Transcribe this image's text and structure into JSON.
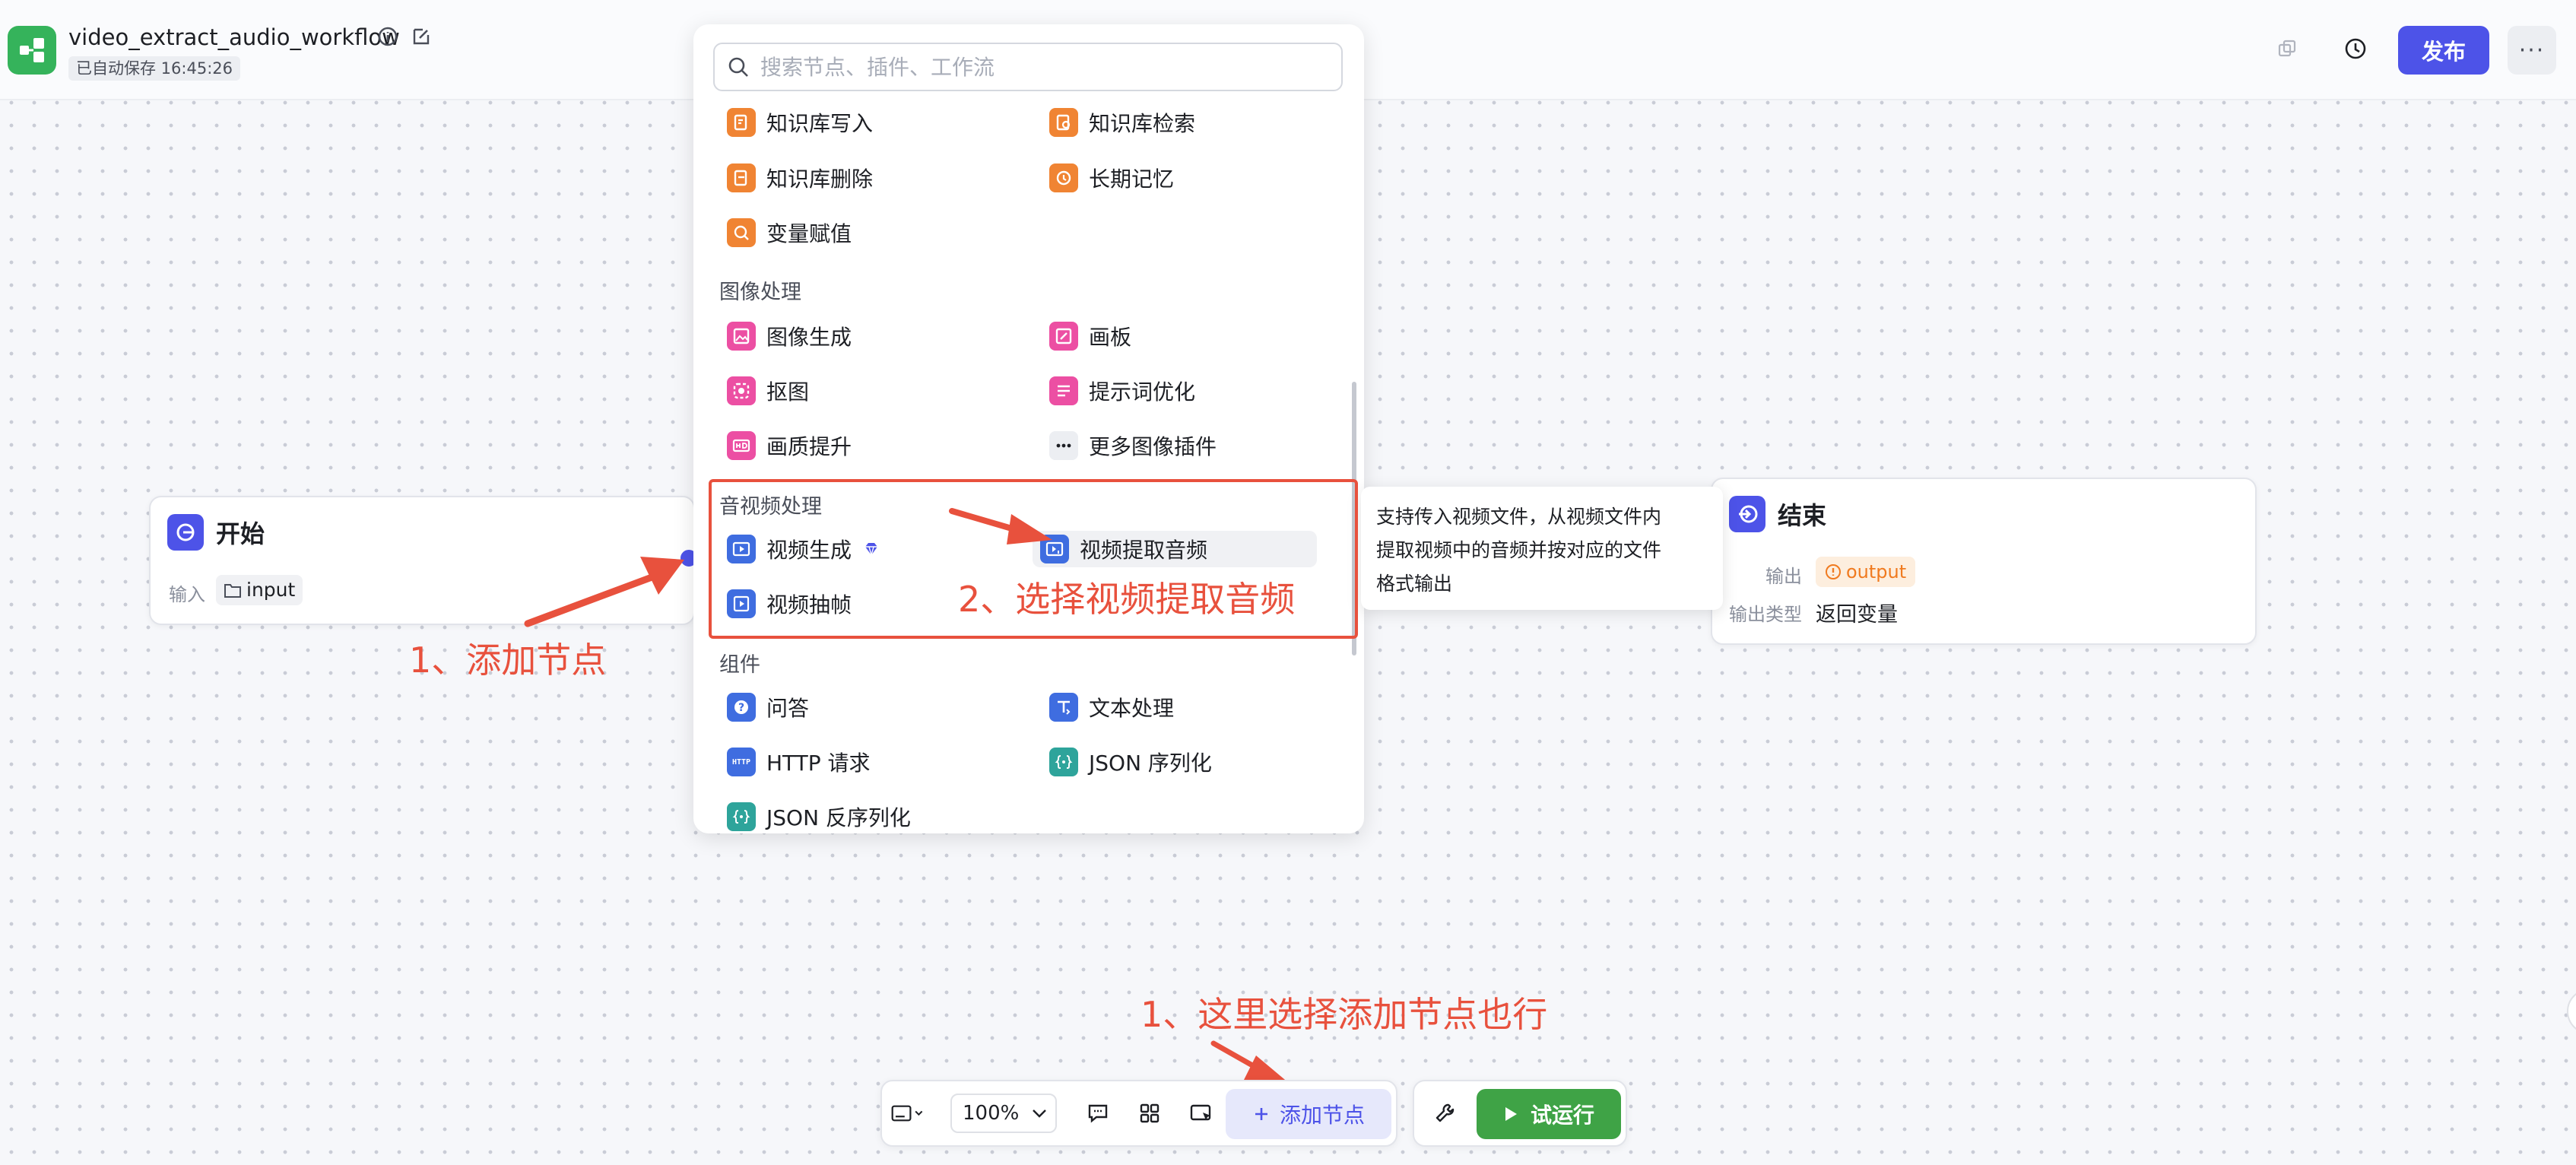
{
  "header": {
    "workflow_title": "video_extract_audio_workflow",
    "autosave": "已自动保存 16:45:26",
    "publish_label": "发布",
    "more_label": "···"
  },
  "start_node": {
    "title": "开始",
    "input_label": "输入",
    "input_var": "input"
  },
  "end_node": {
    "title": "结束",
    "output_label": "输出",
    "output_var": "output",
    "output_type_label": "输出类型",
    "output_type_value": "返回变量"
  },
  "panel": {
    "search_placeholder": "搜索节点、插件、工作流",
    "items_top": [
      "知识库写入",
      "知识库检索",
      "知识库删除",
      "长期记忆",
      "变量赋值"
    ],
    "cat_image": "图像处理",
    "items_image": [
      "图像生成",
      "画板",
      "抠图",
      "提示词优化",
      "画质提升",
      "更多图像插件"
    ],
    "cat_av": "音视频处理",
    "items_av": [
      "视频生成",
      "视频提取音频",
      "视频抽帧"
    ],
    "cat_comp": "组件",
    "items_comp": [
      "问答",
      "文本处理",
      "HTTP 请求",
      "JSON 序列化",
      "JSON 反序列化"
    ],
    "http_badge": "HTTP"
  },
  "tooltip": {
    "lines": [
      "支持传入视频文件，从视频文件内",
      "提取视频中的音频并按对应的文件",
      "格式输出"
    ]
  },
  "annotations": {
    "step1": "1、添加节点",
    "step2": "2、选择视频提取音频",
    "step1_alt": "1、这里选择添加节点也行"
  },
  "toolbar": {
    "zoom": "100%",
    "add_node_label": "添加节点",
    "run_label": "试运行"
  },
  "colors": {
    "brand": "#4d53e8",
    "run_green": "#3fa346",
    "annotation_red": "#e8513d"
  }
}
